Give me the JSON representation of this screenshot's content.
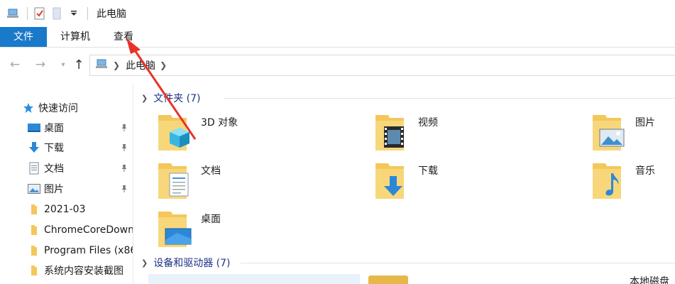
{
  "window": {
    "title": "此电脑"
  },
  "ribbon": {
    "tabs": [
      {
        "label": "文件"
      },
      {
        "label": "计算机"
      },
      {
        "label": "查看"
      }
    ]
  },
  "address": {
    "path": "此电脑"
  },
  "navpane": {
    "quick_access": "快速访问",
    "items": [
      {
        "label": "桌面",
        "icon": "desktop-icon",
        "pinned": true
      },
      {
        "label": "下载",
        "icon": "download-icon",
        "pinned": true
      },
      {
        "label": "文档",
        "icon": "document-icon",
        "pinned": true
      },
      {
        "label": "图片",
        "icon": "picture-icon",
        "pinned": true
      },
      {
        "label": "2021-03",
        "icon": "folder-icon",
        "pinned": false
      },
      {
        "label": "ChromeCoreDown",
        "icon": "folder-icon",
        "pinned": false
      },
      {
        "label": "Program Files (x86",
        "icon": "folder-icon",
        "pinned": false
      },
      {
        "label": "系统内容安装截图",
        "icon": "folder-icon",
        "pinned": false
      }
    ]
  },
  "content": {
    "folders_header": "文件夹 (7)",
    "folders": [
      {
        "label": "3D 对象",
        "icon": "3d-objects-folder-icon"
      },
      {
        "label": "视频",
        "icon": "videos-folder-icon"
      },
      {
        "label": "图片",
        "icon": "pictures-folder-icon"
      },
      {
        "label": "文档",
        "icon": "documents-folder-icon"
      },
      {
        "label": "下载",
        "icon": "downloads-folder-icon"
      },
      {
        "label": "音乐",
        "icon": "music-folder-icon"
      },
      {
        "label": "桌面",
        "icon": "desktop-folder-icon"
      }
    ],
    "devices_header": "设备和驱动器 (7)",
    "drive_label": "本地磁盘"
  },
  "colors": {
    "accent": "#1979ca",
    "group_header": "#1e3287",
    "annotation": "#e8332a",
    "folder": "#f4c75a"
  }
}
